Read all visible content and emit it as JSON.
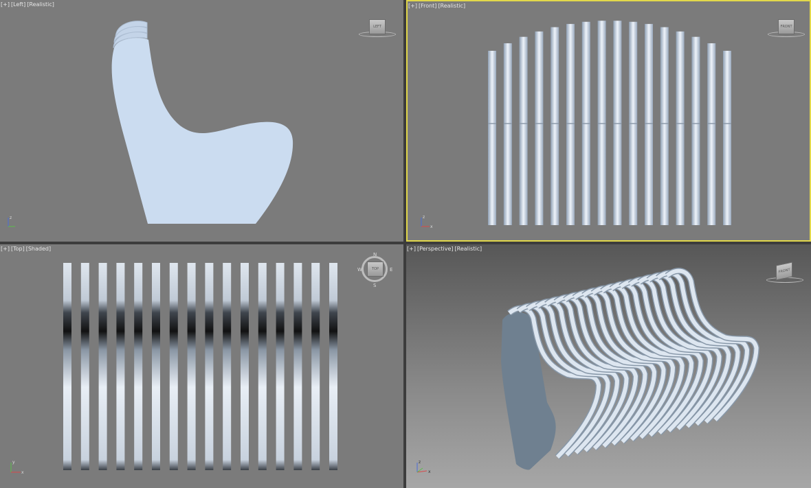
{
  "viewports": [
    {
      "id": "left",
      "labels": [
        "[+]",
        "[Left]",
        "[Realistic]"
      ],
      "viewcube": "LEFT"
    },
    {
      "id": "front",
      "labels": [
        "[+]",
        "[Front]",
        "[Realistic]"
      ],
      "viewcube": "FRONT",
      "active": true
    },
    {
      "id": "top",
      "labels": [
        "[+]",
        "[Top]",
        "[Shaded]"
      ],
      "viewcube": "TOP",
      "compass": [
        "N",
        "E",
        "S",
        "W"
      ]
    },
    {
      "id": "perspective",
      "labels": [
        "[+]",
        "[Perspective]",
        "[Realistic]"
      ],
      "viewcube": "FRONT"
    }
  ],
  "axes": {
    "x": "x",
    "y": "y",
    "z": "z"
  },
  "colors": {
    "active_border": "#e2d84a",
    "viewport_bg": "#7b7b7b",
    "model": "#c9d9ec"
  }
}
